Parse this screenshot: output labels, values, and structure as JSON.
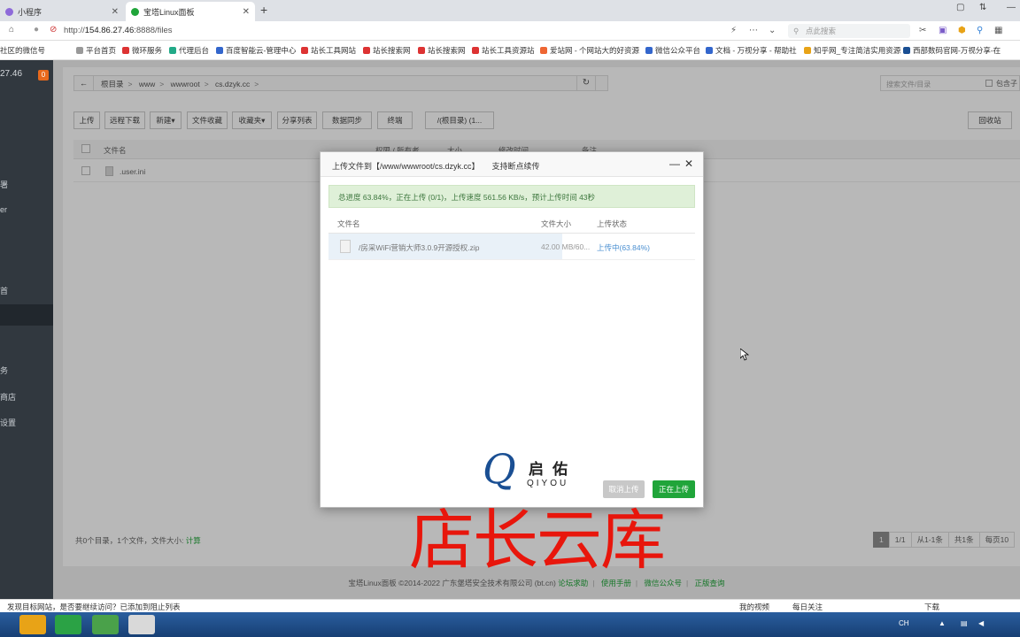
{
  "browser": {
    "tabs": [
      {
        "title": "小程序",
        "active": false
      },
      {
        "title": "宝塔Linux面板",
        "active": true
      }
    ],
    "url_prefix": "http://",
    "url_host": "154.86.27.46",
    "url_rest": ":8888/files",
    "search_placeholder": "点此搜索",
    "bookmarks": [
      "社区的微信号",
      "平台首页",
      "微环服务",
      "代理后台",
      "百度智能云-管理中心",
      "站长工具网站",
      "站长搜索网",
      "站长搜索网",
      "站长工具资源站",
      "爱站网 - 个网站大的好资源",
      "微信公众平台",
      "文档 - 万视分享 - 帮助社",
      "知乎网_专注简洁实用资源",
      "西部数码官网-万视分享-在"
    ]
  },
  "sidebar": {
    "ip": "27.46",
    "badge": "0",
    "items": [
      "署",
      "er",
      "首",
      "务",
      "商店",
      "设置"
    ]
  },
  "filemanager": {
    "back_label": "←",
    "breadcrumbs": [
      "根目录",
      "www",
      "wwwroot",
      "cs.dzyk.cc"
    ],
    "search_placeholder": "搜索文件/目录",
    "search_checkbox_label": "包含子",
    "toolbar": [
      "上传",
      "远程下载",
      "新建▾",
      "文件收藏",
      "收藏夹▾",
      "分享列表",
      "数据同步",
      "终端",
      "/(根目录) (1..."
    ],
    "recycle_label": "回收站",
    "columns": [
      "文件名",
      "权限 / 所有者",
      "大小",
      "修改时间",
      "备注"
    ],
    "rows": [
      {
        "name": ".user.ini"
      }
    ],
    "summary_text": "共0个目录，1个文件，文件大小:",
    "summary_link": "计算",
    "pagination": [
      "1",
      "1/1",
      "从1-1条",
      "共1条",
      "每页10"
    ]
  },
  "footer": {
    "copyright": "宝塔Linux面板 ©2014-2022 广东堡塔安全技术有限公司 (bt.cn)",
    "links": [
      "论坛求助",
      "使用手册",
      "微信公众号",
      "正版查询"
    ]
  },
  "status_bar": {
    "message": "发现目标网站，是否要继续访问？已添加到阻止列表",
    "items": [
      "我的视频",
      "每日关注",
      "下载"
    ]
  },
  "taskbar": {
    "tray_text": "CH"
  },
  "upload_modal": {
    "title": "上传文件到【/www/wwwroot/cs.dzyk.cc】",
    "subtitle": "支持断点续传",
    "progress_text": "总进度 63.84%，正在上传 (0/1)，上传速度 561.56 KB/s，预计上传时间 43秒",
    "progress_fraction": 0.6384,
    "columns": [
      "文件名",
      "文件大小",
      "上传状态"
    ],
    "file_name": "/房采WiFi营销大师3.0.9开源授权.zip",
    "file_size": "42.00 MB/60...",
    "file_status": "上传中(63.84%)",
    "logo_cn": "启佑",
    "logo_en": "QIYOU",
    "cancel_label": "取消上传",
    "upload_label": "正在上传"
  },
  "watermark": "店长云库",
  "colors": {
    "sidebar": "#31383f",
    "accent_green": "#20a53a",
    "watermark_red": "#e8160c",
    "progress_bg": "#dff0d8"
  }
}
